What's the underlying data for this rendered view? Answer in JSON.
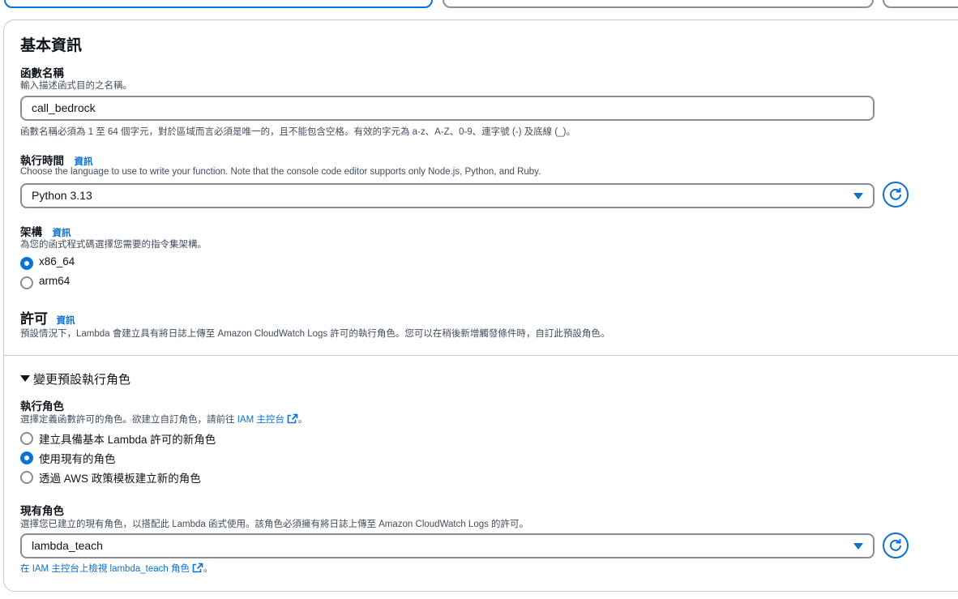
{
  "basic_info": {
    "title": "基本資訊",
    "function_name": {
      "label": "函數名稱",
      "description": "輸入描述函式目的之名稱。",
      "value": "call_bedrock",
      "hint": "函數名稱必須為 1 至 64 個字元，對於區域而言必須是唯一的，且不能包含空格。有效的字元為 a-z、A-Z、0-9、連字號 (-) 及底線 (_)。"
    },
    "runtime": {
      "label": "執行時間",
      "info": "資訊",
      "description": "Choose the language to use to write your function. Note that the console code editor supports only Node.js, Python, and Ruby.",
      "value": "Python 3.13"
    },
    "architecture": {
      "label": "架構",
      "info": "資訊",
      "description": "為您的函式程式碼選擇您需要的指令集架構。",
      "options": [
        "x86_64",
        "arm64"
      ],
      "selected": "x86_64"
    },
    "permissions": {
      "title": "許可",
      "info": "資訊",
      "description": "預設情況下，Lambda 會建立具有將日誌上傳至 Amazon CloudWatch Logs 許可的執行角色。您可以在稍後新增觸發條件時，自訂此預設角色。"
    }
  },
  "change_role": {
    "expander": "變更預設執行角色",
    "execution_role": {
      "label": "執行角色",
      "description_prefix": "選擇定義函數許可的角色。欲建立自訂角色，請前往",
      "iam_link": "IAM 主控台",
      "description_suffix": "。",
      "options": [
        "建立具備基本 Lambda 許可的新角色",
        "使用現有的角色",
        "透過 AWS 政策模板建立新的角色"
      ],
      "selected": "使用現有的角色"
    },
    "existing_role": {
      "label": "現有角色",
      "description": "選擇您已建立的現有角色，以搭配此 Lambda 函式使用。該角色必須擁有將日誌上傳至 Amazon CloudWatch Logs 的許可。",
      "value": "lambda_teach",
      "view_link": "在 IAM 主控台上檢視 lambda_teach 角色",
      "view_suffix": "。"
    }
  },
  "colors": {
    "accent": "#0972d3",
    "border": "#8c8c94",
    "text": "#0f141a",
    "muted": "#414d5c"
  },
  "icons": [
    "refresh-icon",
    "caret-down-icon",
    "external-link-icon",
    "triangle-down-icon"
  ]
}
